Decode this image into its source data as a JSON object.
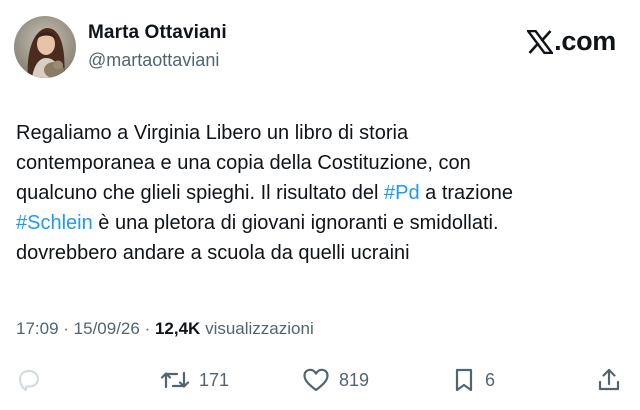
{
  "author": {
    "name": "Marta Ottaviani",
    "handle": "@martaottaviani"
  },
  "brand": {
    "wordmark": ".com",
    "logo_icon": "x-logo-icon"
  },
  "tweet": {
    "lines": [
      [
        {
          "text": "Regaliamo a Virginia Libero un libro di storia"
        }
      ],
      [
        {
          "text": "contemporanea e una copia della Costituzione, con"
        }
      ],
      [
        {
          "text": "qualcuno che glieli spieghi. Il risultato del "
        },
        {
          "text": "#Pd",
          "hashtag": true
        },
        {
          "text": " a trazione"
        }
      ],
      [
        {
          "text": "#Schlein",
          "hashtag": true
        },
        {
          "text": " è una pletora di giovani ignoranti e smidollati."
        }
      ],
      [
        {
          "text": "dovrebbero andare a scuola da quelli ucraini"
        }
      ]
    ]
  },
  "meta": {
    "time": "17:09",
    "separator": " · ",
    "date": "15/09/26",
    "views_count": "12,4K",
    "views_label": "visualizzazioni"
  },
  "actions": {
    "reply": {
      "icon": "reply-icon",
      "count": ""
    },
    "repost": {
      "icon": "repost-icon",
      "count": "171"
    },
    "like": {
      "icon": "heart-icon",
      "count": "819"
    },
    "bookmark": {
      "icon": "bookmark-icon",
      "count": "6"
    },
    "share": {
      "icon": "share-icon",
      "count": ""
    }
  },
  "colors": {
    "text": "#0f1419",
    "secondary": "#536471",
    "hashtag": "#1d9bf0",
    "reply_icon": "#cfd9de"
  }
}
